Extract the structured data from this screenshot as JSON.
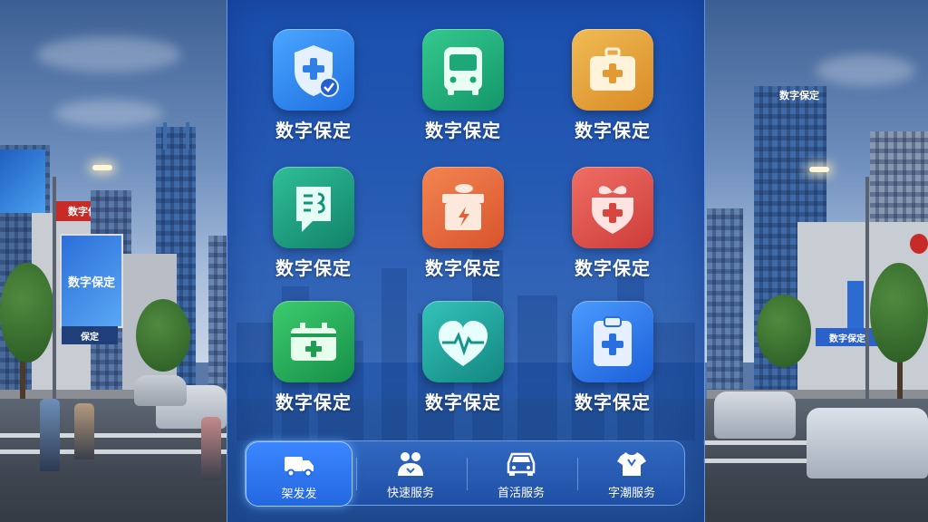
{
  "tiles": [
    {
      "label": "数字保定",
      "icon": "shield-plus-icon",
      "color": "#2f8ef0"
    },
    {
      "label": "数字保定",
      "icon": "bus-icon",
      "color": "#1fae7a"
    },
    {
      "label": "数字保定",
      "icon": "medical-kit-icon",
      "color": "#e2a23a"
    },
    {
      "label": "数字保定",
      "icon": "chat-document-icon",
      "color": "#1d9f7f"
    },
    {
      "label": "数字保定",
      "icon": "power-box-icon",
      "color": "#e8683a"
    },
    {
      "label": "数字保定",
      "icon": "gift-medical-icon",
      "color": "#e0574f"
    },
    {
      "label": "数字保定",
      "icon": "battery-plus-icon",
      "color": "#23a85c"
    },
    {
      "label": "数字保定",
      "icon": "heart-pulse-icon",
      "color": "#1fa7a0"
    },
    {
      "label": "数字保定",
      "icon": "clipboard-plus-icon",
      "color": "#2f7cf0"
    }
  ],
  "nav": [
    {
      "label": "架发发",
      "icon": "delivery-truck-icon",
      "active": true
    },
    {
      "label": "快速服务",
      "icon": "people-service-icon",
      "active": false
    },
    {
      "label": "首活服务",
      "icon": "car-icon",
      "active": false
    },
    {
      "label": "字潮服务",
      "icon": "shirt-icon",
      "active": false
    }
  ],
  "background_signs": {
    "left_billboard": "数字保定",
    "left_roof_sign": "数字保定",
    "left_shop": "保定",
    "right_tower": "数字保定",
    "right_shop": "数字保定"
  }
}
